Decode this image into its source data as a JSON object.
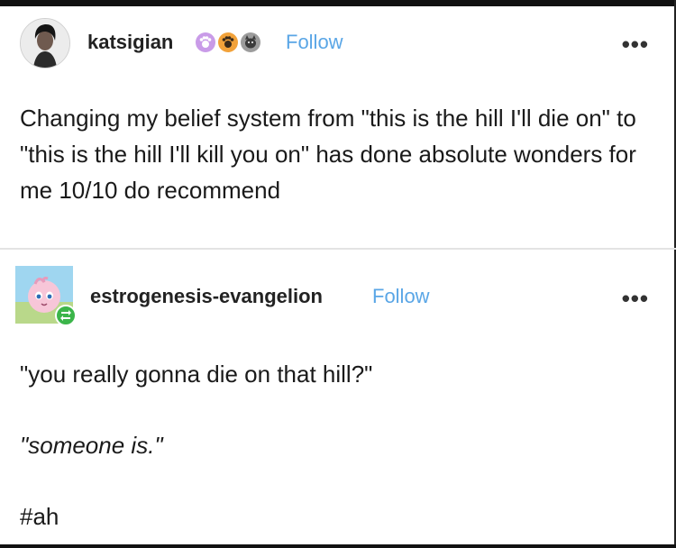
{
  "post1": {
    "username": "katsigian",
    "follow_label": "Follow",
    "more_label": "•••",
    "body": "Changing my belief system from \"this is the hill I'll die on\" to \"this is the hill I'll kill you on\" has done absolute wonders for me 10/10 do recommend",
    "badges": [
      "paw-badge-icon",
      "paw-badge-icon",
      "pet-badge-icon"
    ]
  },
  "post2": {
    "username": "estrogenesis-evangelion",
    "follow_label": "Follow",
    "more_label": "•••",
    "quote1": "\"you really gonna die on that hill?\"",
    "quote2": "\"someone is.\"",
    "tag": "#ah"
  },
  "colors": {
    "follow": "#5aa6e6",
    "reblog": "#3bb54a",
    "text": "#1a1a1a"
  }
}
